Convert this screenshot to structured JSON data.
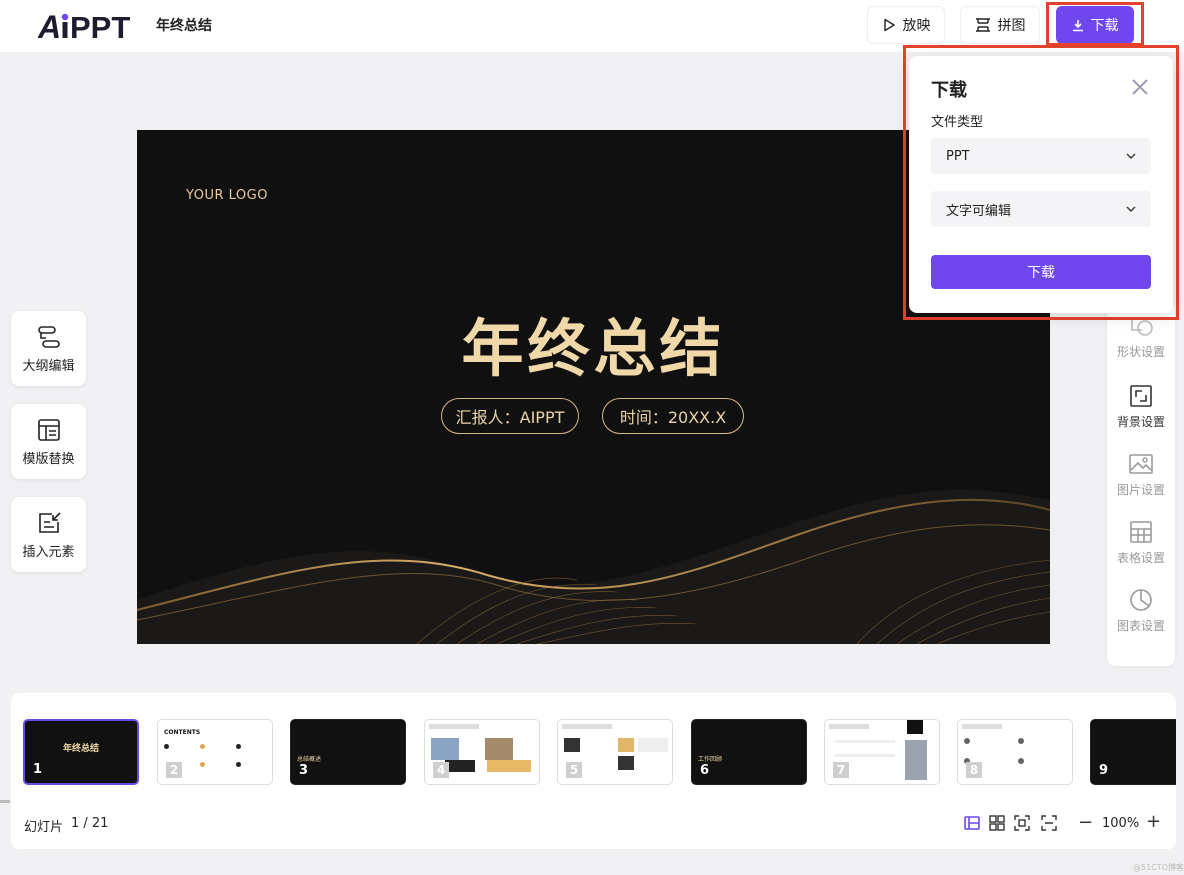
{
  "app": {
    "logo_text": "AiPPT",
    "doc_title": "年终总结"
  },
  "toolbar": {
    "play_label": "放映",
    "puzzle_label": "拼图",
    "download_label": "下载"
  },
  "left_tools": [
    {
      "label": "大纲编辑",
      "icon": "outline-icon"
    },
    {
      "label": "模版替换",
      "icon": "template-icon"
    },
    {
      "label": "插入元素",
      "icon": "insert-element-icon"
    }
  ],
  "slide": {
    "logo_text": "YOUR LOGO",
    "title": "年终总结",
    "reporter": "汇报人：AIPPT",
    "time": "时间：20XX.X"
  },
  "right_panel": [
    {
      "label": "形状设置",
      "icon": "shape-icon"
    },
    {
      "label": "背景设置",
      "icon": "background-icon"
    },
    {
      "label": "图片设置",
      "icon": "image-icon"
    },
    {
      "label": "表格设置",
      "icon": "table-icon"
    },
    {
      "label": "图表设置",
      "icon": "chart-icon"
    }
  ],
  "download_popup": {
    "title": "下载",
    "file_type_label": "文件类型",
    "file_type_value": "PPT",
    "edit_mode_value": "文字可编辑",
    "submit_label": "下载"
  },
  "thumbnails": [
    {
      "num": "1",
      "theme": "dark",
      "title": "年终总结"
    },
    {
      "num": "2",
      "theme": "light",
      "title": "CONTENTS"
    },
    {
      "num": "3",
      "theme": "dark",
      "title": "总结概述"
    },
    {
      "num": "4",
      "theme": "light",
      "title": ""
    },
    {
      "num": "5",
      "theme": "light",
      "title": ""
    },
    {
      "num": "6",
      "theme": "dark",
      "title": "工作回顾"
    },
    {
      "num": "7",
      "theme": "light",
      "title": ""
    },
    {
      "num": "8",
      "theme": "light",
      "title": ""
    },
    {
      "num": "9",
      "theme": "dark",
      "title": ""
    }
  ],
  "footer": {
    "slide_label": "幻灯片",
    "slide_count": "1 / 21",
    "zoom": "100%",
    "zoom_out": "−",
    "zoom_in": "+"
  },
  "watermark": "@51CTO博客",
  "colors": {
    "accent": "#7046ee",
    "highlight_box": "#e4422d",
    "slide_gold": "#f0d8a8",
    "slide_bg": "#111010"
  }
}
